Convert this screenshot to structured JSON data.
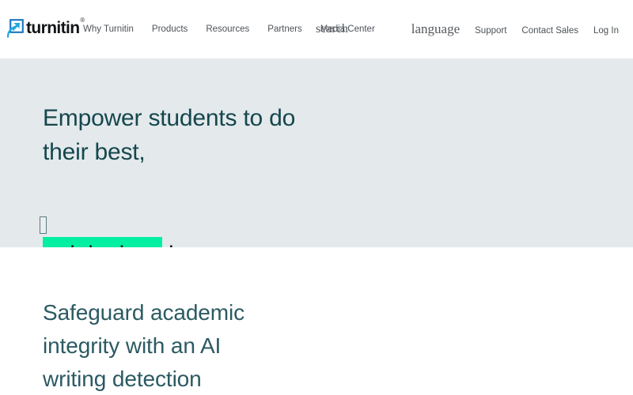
{
  "header": {
    "logo": {
      "icon": "turnitin-arrow-logo-icon",
      "wordmark": "turnitin",
      "trademark": "®"
    },
    "primary_nav": [
      {
        "label": "Why Turnitin"
      },
      {
        "label": "Products"
      },
      {
        "label": "Resources"
      },
      {
        "label": "Partners"
      },
      {
        "label": "Media Center"
      }
    ],
    "search": {
      "label": "search"
    },
    "secondary_nav": {
      "language_label": "language",
      "items": [
        {
          "label": "Support"
        },
        {
          "label": "Contact Sales"
        },
        {
          "label": "Log In"
        }
      ]
    }
  },
  "hero": {
    "background_color": "#e4e9ec",
    "heading_color": "#14474d",
    "heading_lines": [
      "Empower students to do",
      "their best,"
    ],
    "highlighted_phrase": "original work",
    "highlight_color": "#00efa0",
    "selection": {
      "start_handle": "selection-start-handle",
      "end_handle": "selection-end-handle"
    }
  },
  "lower_section": {
    "background_color": "#ffffff",
    "heading_color": "#2b5a62",
    "heading_lines": [
      "Safeguard academic",
      "integrity with an AI",
      "writing detection"
    ]
  }
}
